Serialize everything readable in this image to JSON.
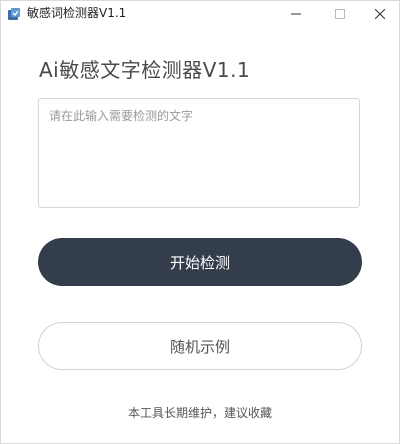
{
  "window": {
    "title": "敏感词检测器V1.1",
    "app_icon": "app-logo-icon",
    "controls": [
      "minimize-icon",
      "maximize-icon",
      "close-icon"
    ]
  },
  "main": {
    "heading": "Ai敏感文字检测器V1.1",
    "input": {
      "placeholder": "请在此输入需要检测的文字",
      "value": ""
    },
    "start_button_label": "开始检测",
    "example_button_label": "随机示例",
    "footer_text": "本工具长期维护，建议收藏"
  },
  "colors": {
    "primary_button": "#333d4b",
    "primary_button_text": "#ffffff",
    "heading_text": "#4a4a4a",
    "border": "#d6d6d6"
  }
}
